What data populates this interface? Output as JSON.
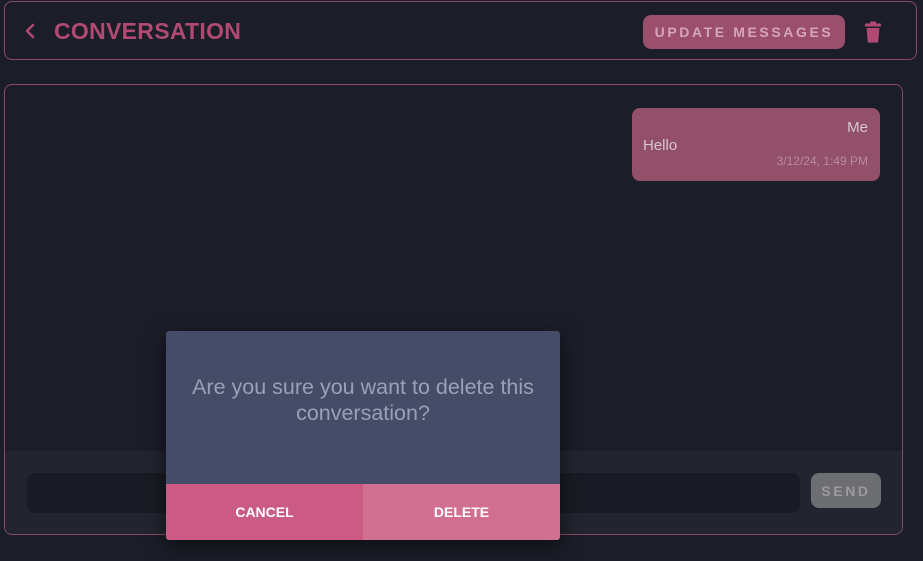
{
  "header": {
    "back_icon": "chevron-left-icon",
    "title": "CONVERSATION",
    "update_button_label": "UPDATE MESSAGES",
    "delete_icon": "trash-icon"
  },
  "messages": [
    {
      "sender": "Me",
      "text": "Hello",
      "timestamp": "3/12/24, 1:49 PM"
    }
  ],
  "composer": {
    "input_value": "",
    "input_placeholder": "",
    "send_label": "SEND"
  },
  "dialog": {
    "message": "Are you sure you want to delete this conversation?",
    "cancel_label": "CANCEL",
    "delete_label": "DELETE"
  },
  "colors": {
    "background": "#1b1d28",
    "accent": "#b04a72",
    "border": "#8a4a66",
    "bubble": "#925069",
    "dialog_bg": "#454c67",
    "cancel": "#cb5a84",
    "delete": "#d06f90"
  }
}
